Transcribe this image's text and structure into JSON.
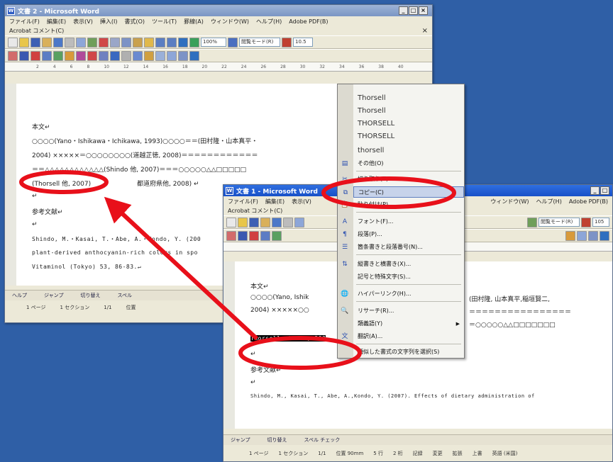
{
  "back_window": {
    "title": "文書 2 - Microsoft Word",
    "menu": [
      "ファイル(F)",
      "編集(E)",
      "表示(V)",
      "挿入(I)",
      "書式(O)",
      "ツール(T)",
      "罫線(A)",
      "ウィンドウ(W)",
      "ヘルプ(H)",
      "Adobe PDF(B)"
    ],
    "menu2": "Acrobat コメント(C)",
    "zoom": "100%",
    "reading_mode": "閲覧モード(R)",
    "font_size": "10.5",
    "ruler_ticks": [
      "2",
      "4",
      "6",
      "8",
      "10",
      "12",
      "14",
      "16",
      "18",
      "20",
      "22",
      "24",
      "26",
      "28",
      "30",
      "32",
      "34",
      "36",
      "38",
      "40"
    ],
    "doc_lines": [
      "本文↵",
      "○○○○(Yano・Ishikawa・Ichikawa, 1993)○○○○＝＝(田村隆・山本真平・",
      "2004) ×××××＝○○○○○○○○(道越芷徳, 2008)＝＝＝＝＝＝＝＝＝＝＝＝",
      "＝＝△△△△△△△△△△△△(Shindo 他, 2007)＝＝＝○○○○○△△□□□□□",
      "(Thorsell 他, 2007)",
      "都道府県他, 2008) ↵",
      "↵",
      "参考文献↵",
      "↵",
      "Shindo, M.・Kasai, T.・Abe, A.・Kondo, Y. (200",
      "plant-derived anthocyanin-rich colors in spo",
      "Vitaminol (Tokyo) 53, 86-83.↵"
    ],
    "taskbar": [
      "ヘルプ",
      "ジャンプ",
      "切り替え",
      "スペル"
    ],
    "status": [
      "1 ページ",
      "1 セクション",
      "1/1",
      "位置"
    ]
  },
  "front_window": {
    "title": "文書 1 - Microsoft Word",
    "menu": [
      "ファイル(F)",
      "編集(E)",
      "表示(V)"
    ],
    "menu_right": [
      "ウィンドウ(W)",
      "ヘルプ(H)",
      "Adobe PDF(B)"
    ],
    "menu2": "Acrobat コメント(C)",
    "reading_mode": "閲覧モード(R)",
    "font_size": "105",
    "doc_lines": [
      "本文↵",
      "○○○○(Yano, Ishik",
      "2004) ×××××○○",
      "Thorsell et al., 200",
      "↵",
      "参考文献↵",
      "↵",
      "Shindo, M., Kasai, T., Abe, A.,Kondo, Y. (2007). Effects of dietary administration of"
    ],
    "doc_right_lines": [
      "(田村隆, 山本真平,稲垣賢二,",
      "＝＝＝＝＝＝＝＝＝＝＝＝＝＝＝＝",
      "＝○○○○○△△□□□□□□□"
    ],
    "taskbar": [
      "ジャンプ",
      "切り替え",
      "スペル チェック"
    ],
    "status": [
      "1 ページ",
      "1 セクション",
      "1/1",
      "位置 90mm",
      "5 行",
      "2 桁",
      "記録",
      "変更",
      "拡張",
      "上書",
      "英語 (米国)"
    ]
  },
  "context_menu": {
    "fonts": [
      "Thorsell",
      "Thorsell",
      "THORSELL",
      "THORSELL",
      "thorsell"
    ],
    "items": [
      "その他(O)",
      "切り取り(T)",
      "コピー(C)",
      "貼り付け(P)",
      "フォント(F)...",
      "段落(P)...",
      "箇条書きと段落番号(N)...",
      "縦書きと横書き(X)...",
      "記号と特殊文字(S)...",
      "ハイパーリンク(H)...",
      "リサーチ(R)...",
      "類義語(Y)",
      "翻訳(A)...",
      "類似した書式の文字列を選択(S)"
    ],
    "selected_index": 2
  },
  "colors": {
    "desktop": "#2f5fa6",
    "highlight_ring": "#e8101a",
    "arrow": "#e8101a"
  }
}
